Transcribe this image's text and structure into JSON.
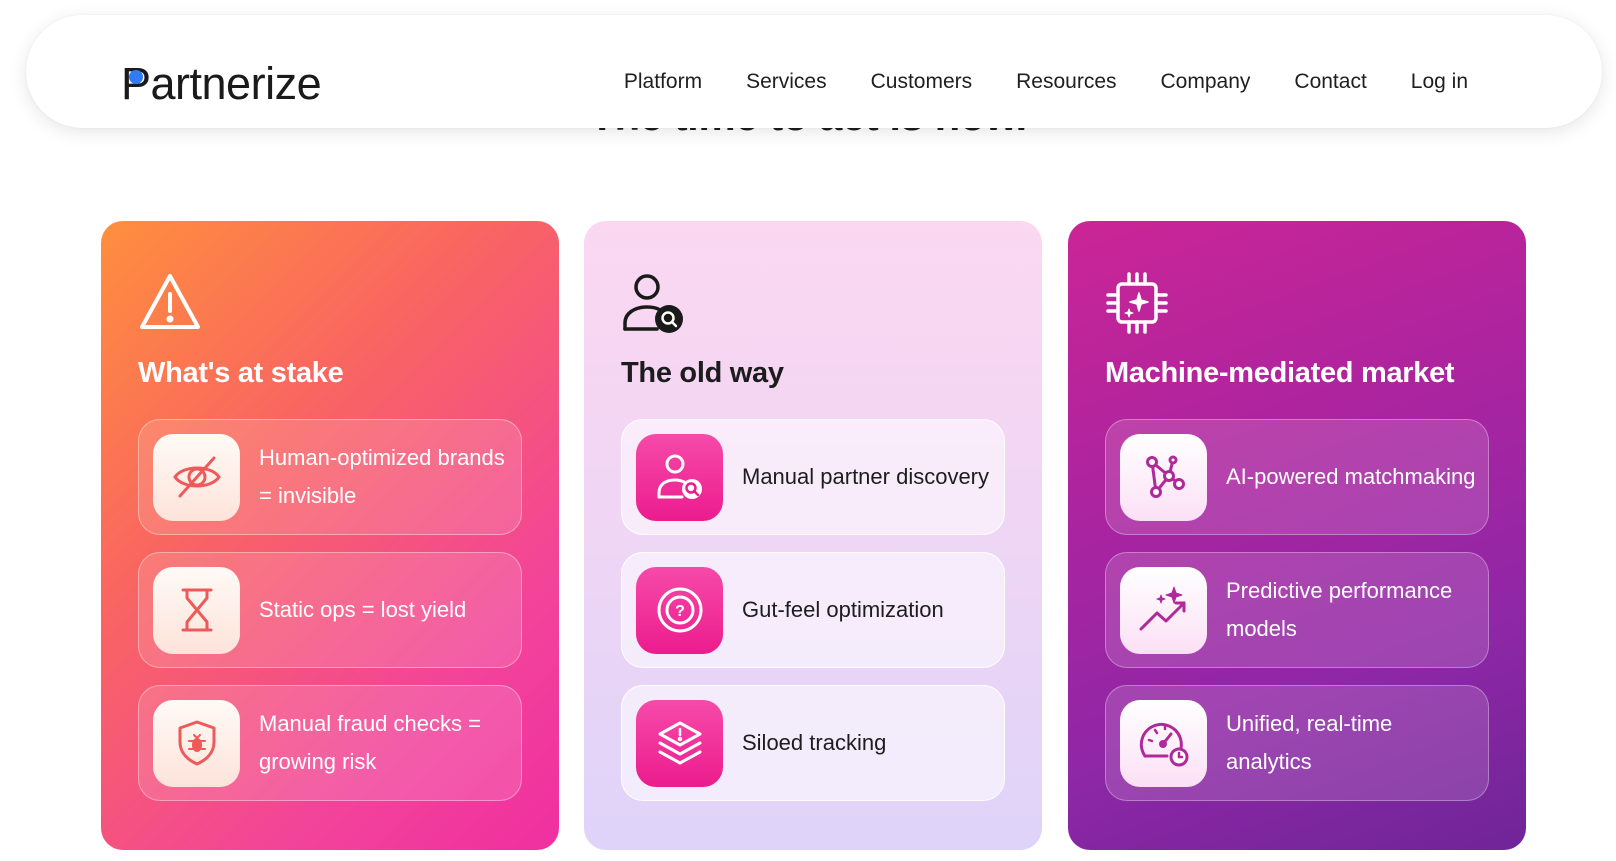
{
  "nav": {
    "logo": "Partnerize",
    "links": [
      "Platform",
      "Services",
      "Customers",
      "Resources",
      "Company",
      "Contact",
      "Log in"
    ]
  },
  "headline": "The time to act is now.",
  "colors": {
    "logo_dot": "#2f7cf6",
    "stake_gradient": [
      "#ff8f3d",
      "#f02fa0"
    ],
    "old_gradient": [
      "#fbd7f1",
      "#dfd3f9"
    ],
    "mm_gradient": [
      "#cb2596",
      "#6f2597"
    ],
    "icon_pink": "#ec1c8e"
  },
  "cards": [
    {
      "title": "What's at stake",
      "icon": "warning-triangle-icon",
      "items": [
        {
          "icon": "eye-slash-icon",
          "text": "Human-optimized brands = invisible"
        },
        {
          "icon": "hourglass-icon",
          "text": "Static ops = lost yield"
        },
        {
          "icon": "shield-bug-icon",
          "text": "Manual fraud  checks = growing risk"
        }
      ]
    },
    {
      "title": "The old way",
      "icon": "user-search-icon",
      "items": [
        {
          "icon": "user-search-icon",
          "text": "Manual partner discovery"
        },
        {
          "icon": "target-question-icon",
          "text": "Gut-feel optimization"
        },
        {
          "icon": "layers-alert-icon",
          "text": "Siloed tracking"
        }
      ]
    },
    {
      "title": "Machine-mediated market",
      "icon": "ai-chip-icon",
      "items": [
        {
          "icon": "network-nodes-icon",
          "text": "AI-powered matchmaking"
        },
        {
          "icon": "trend-sparkle-icon",
          "text": "Predictive performance models"
        },
        {
          "icon": "speedometer-clock-icon",
          "text": "Unified, real-time analytics"
        }
      ]
    }
  ]
}
